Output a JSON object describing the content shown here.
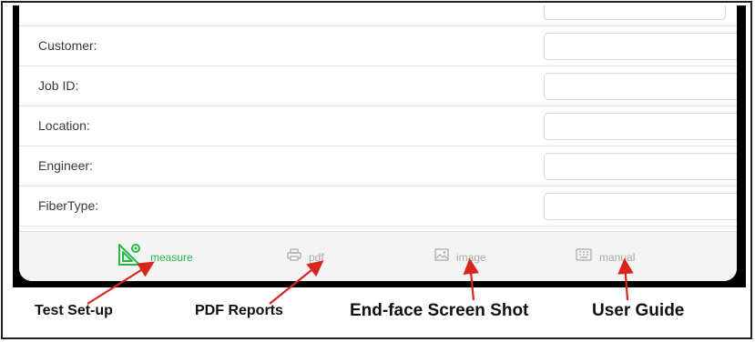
{
  "form": {
    "fields": [
      {
        "label": "Customer:",
        "value": ""
      },
      {
        "label": "Job ID:",
        "value": ""
      },
      {
        "label": "Location:",
        "value": ""
      },
      {
        "label": "Engineer:",
        "value": ""
      },
      {
        "label": "FiberType:",
        "value": ""
      }
    ]
  },
  "tabbar": {
    "tabs": [
      {
        "label": "measure",
        "icon": "set-square-icon",
        "active": true
      },
      {
        "label": "pdf",
        "icon": "printer-icon",
        "active": false
      },
      {
        "label": "image",
        "icon": "image-icon",
        "active": false
      },
      {
        "label": "manual",
        "icon": "keyboard-icon",
        "active": false
      }
    ]
  },
  "annotations": {
    "test_setup": "Test Set-up",
    "pdf_reports": "PDF Reports",
    "endface": "End-face Screen Shot",
    "user_guide": "User Guide"
  },
  "colors": {
    "accent_green": "#27b84a",
    "arrow_red": "#d9261c",
    "inactive_tab": "#a8a8a8"
  }
}
